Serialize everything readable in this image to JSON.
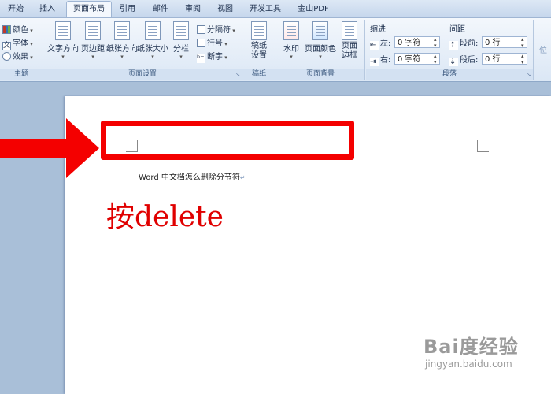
{
  "tabs": [
    "开始",
    "插入",
    "页面布局",
    "引用",
    "邮件",
    "审阅",
    "视图",
    "开发工具",
    "金山PDF"
  ],
  "active_tab": "页面布局",
  "ribbon": {
    "theme": {
      "colors": "颜色",
      "fonts": "字体",
      "effects": "效果",
      "label": "主题"
    },
    "page_setup": {
      "text_direction": "文字方向",
      "margins": "页边距",
      "orientation": "纸张方向",
      "size": "纸张大小",
      "columns": "分栏",
      "breaks": "分隔符",
      "line_numbers": "行号",
      "hyphenation": "断字",
      "label": "页面设置"
    },
    "manuscript": {
      "setup": "稿纸\n设置",
      "label": "稿纸"
    },
    "page_background": {
      "watermark": "水印",
      "page_color": "页面颜色",
      "page_borders": "页面\n边框",
      "label": "页面背景"
    },
    "paragraph": {
      "indent_title": "缩进",
      "spacing_title": "间距",
      "left": "左:",
      "right": "右:",
      "before": "段前:",
      "after": "段后:",
      "indent_left_value": "0 字符",
      "indent_right_value": "0 字符",
      "spacing_before_value": "0 行",
      "spacing_after_value": "0 行",
      "label": "段落"
    },
    "arrange_cut": "位"
  },
  "document": {
    "body_text": "Word 中文档怎么删除分节符",
    "annotation": "按delete"
  },
  "watermark": {
    "logo": "Bai度经验",
    "url": "jingyan.baidu.com"
  },
  "colors": {
    "annotation_red": "#f40000"
  }
}
